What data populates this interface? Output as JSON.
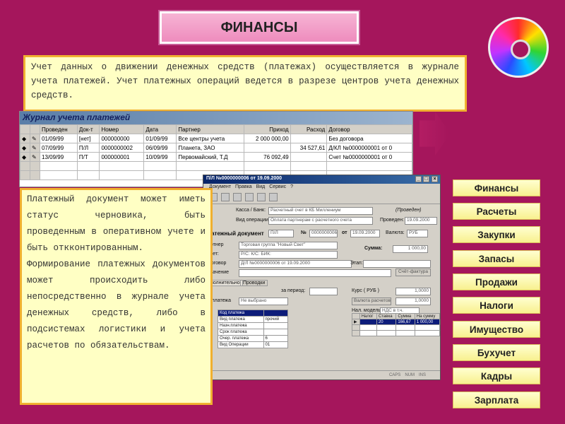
{
  "header": {
    "title": "ФИНАНСЫ"
  },
  "intro": {
    "text": "Учет данных о движении денежных средств (платежах) осуществляется в журнале учета платежей. Учет платежных операций ведется в разрезе центров учета денежных средств."
  },
  "journal": {
    "title": "Журнал учета платежей",
    "columns": [
      "Проведен",
      "Док-т",
      "Номер",
      "Дата",
      "Партнер",
      "Приход",
      "Расход",
      "Договор"
    ],
    "rows": [
      [
        "01/09/99",
        "[нет]",
        "000000000",
        "01/09/99",
        "Все центры учета",
        "2 000 000,00",
        "",
        "Без договора"
      ],
      [
        "07/09/99",
        "П/Л",
        "0000000002",
        "06/09/99",
        "Планета, ЗАО",
        "",
        "34 527,61",
        "Д/КЛ №0000000001 от 0"
      ],
      [
        "13/09/99",
        "П/Т",
        "000000001",
        "10/09/99",
        "Первомайский, Т.Д",
        "76 092,49",
        "",
        "Счет №0000000001 от 0"
      ]
    ]
  },
  "payment_window": {
    "title": "П/Л №0000000006 от 19.09.2000",
    "menu": "Документ  Правка  Вид  Сервис  ?",
    "kassa_label": "Касса / Банк:",
    "kassa_value": "Расчетный счет в КБ Миллениум",
    "op_label": "Вид операции:",
    "op_value": "Оплата партнерам с расчетного счета",
    "status": "(Проведен)",
    "posted_label": "Проведен:",
    "posted_value": "19.09.2000",
    "doc_label": "латежный документ",
    "doc_type": "П/Л",
    "num_label": "№",
    "num_value": "0000000006",
    "from_label": "от",
    "from_value": "19.09.2000",
    "currency_label": "Валюта:",
    "currency_value": "РУБ",
    "partner_label": "артнер",
    "partner_value": "Торговая группа \"Новый Свет\"",
    "account_label": "счет:",
    "account_value": "Р/С: К/С: БИК:",
    "contract_label": "Договор",
    "contract_value": "Д/Л №0000000006 от 19.09.2000",
    "sum_label": "Сумма:",
    "sum_value": "1 000,00",
    "stage_label": "Этап:",
    "invoice_button": "Счёт-фактура",
    "purpose_label": "значение",
    "tab_extra": "полнительно",
    "tab_postings": "Проводки",
    "period_label": "за период:",
    "course_label": "Курс ( РУБ )",
    "course_value": "1,0000",
    "currency_calc_label": "Валюта расчетов",
    "currency_calc_value": "1,0000",
    "type_label": "р платежа",
    "type_value": "Не выбрано",
    "tax_label": "Нал. модель",
    "tax_value": "НДС в т.ч.",
    "props": [
      [
        "Код платежа",
        ""
      ],
      [
        "Вид платежа",
        "прочий"
      ],
      [
        "Назн.платежа",
        ""
      ],
      [
        "Срок платежа",
        ""
      ],
      [
        "Очер. платежа",
        "6"
      ],
      [
        "Вид Операции",
        "01"
      ]
    ],
    "tax_columns": [
      "Налог",
      "Ставка",
      "Сумма",
      "На сумму"
    ],
    "tax_row": [
      "",
      "20",
      "166,67",
      "1 000,00"
    ],
    "status_items": [
      "CAPS",
      "NUM",
      "INS"
    ]
  },
  "details": {
    "p1": "Платежный документ может иметь статус черновика, быть проведенным в оперативном учете и быть откконтированным.",
    "p2": "Формирование платежных документов может происходить либо непосредственно в журнале учета денежных средств, либо в подсистемах логистики и учета расчетов по обязательствам."
  },
  "nav": [
    "Финансы",
    "Расчеты",
    "Закупки",
    "Запасы",
    "Продажи",
    "Налоги",
    "Имущество",
    "Бухучет",
    "Кадры",
    "Зарплата"
  ],
  "colors": {
    "background": "#a5165c",
    "panel": "#ffffc4",
    "panel_border": "#f0b030",
    "title_box": "#f6b4d4"
  }
}
